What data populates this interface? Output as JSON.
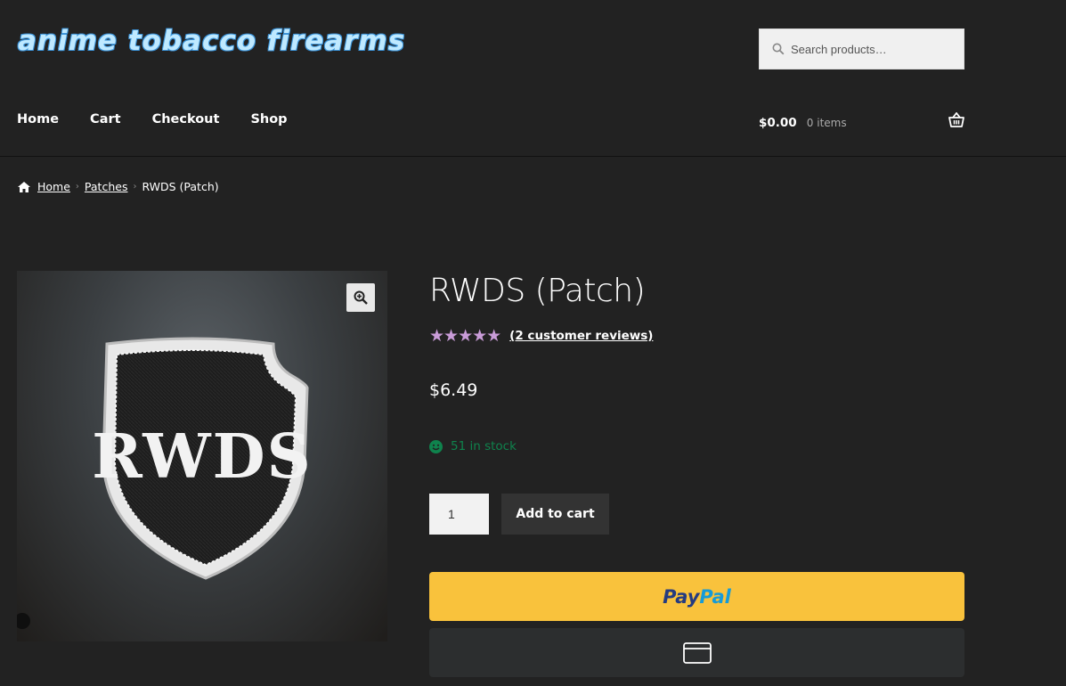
{
  "site": {
    "title": "anime tobacco firearms"
  },
  "search": {
    "placeholder": "Search products…"
  },
  "nav": {
    "items": [
      {
        "label": "Home"
      },
      {
        "label": "Cart"
      },
      {
        "label": "Checkout"
      },
      {
        "label": "Shop"
      }
    ]
  },
  "cart": {
    "amount": "$0.00",
    "items": "0 items"
  },
  "breadcrumb": {
    "home": "Home",
    "category": "Patches",
    "current": "RWDS (Patch)"
  },
  "product": {
    "title": "RWDS (Patch)",
    "rating": 5,
    "reviews_link": "(2 customer reviews)",
    "price": "$6.49",
    "stock": "51 in stock",
    "quantity": "1",
    "add_to_cart": "Add to cart",
    "patch_text": "RWDS"
  },
  "payment": {
    "paypal_pay": "Pay",
    "paypal_pal": "Pal"
  },
  "colors": {
    "background": "#222222",
    "accent_star": "#c99cd8",
    "stock_green": "#0f834d",
    "paypal_yellow": "#f9c23c"
  },
  "icons": {
    "search": "search-icon",
    "basket": "basket-icon",
    "home": "home-icon",
    "zoom": "zoom-icon",
    "stock": "smile-icon",
    "card": "card-icon"
  }
}
